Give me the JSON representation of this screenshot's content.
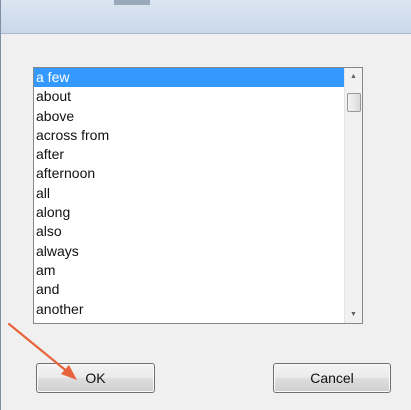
{
  "list": {
    "items": [
      "a few",
      "about",
      "above",
      "across from",
      "after",
      "afternoon",
      "all",
      "along",
      "also",
      "always",
      "am",
      "and",
      "another"
    ],
    "selected_index": 0
  },
  "buttons": {
    "ok_label": "OK",
    "cancel_label": "Cancel"
  },
  "colors": {
    "selection": "#3399ff",
    "annotation_arrow": "#e8643c"
  },
  "icons": {
    "scroll_up": "chevron-up-icon",
    "scroll_down": "chevron-down-icon",
    "annotation": "arrow-pointer-icon"
  }
}
